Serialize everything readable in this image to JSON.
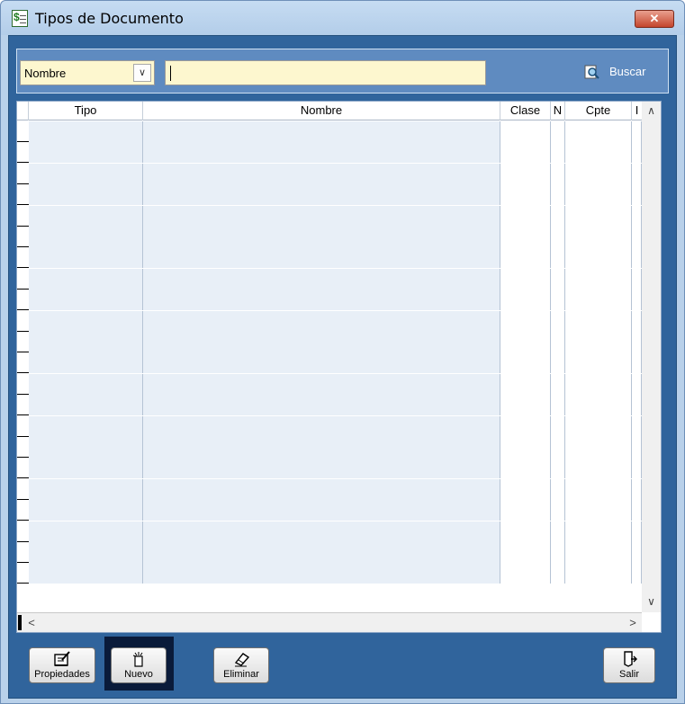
{
  "window": {
    "title": "Tipos de Documento",
    "close_glyph": "✕"
  },
  "search": {
    "field_value": "Nombre",
    "query": "",
    "button_label": "Buscar"
  },
  "grid": {
    "columns": [
      "Tipo",
      "Nombre",
      "Clase",
      "N",
      "Cpte",
      "I"
    ],
    "row_count": 22
  },
  "buttons": {
    "propiedades": "Propiedades",
    "nuevo": "Nuevo",
    "eliminar": "Eliminar",
    "salir": "Salir"
  }
}
